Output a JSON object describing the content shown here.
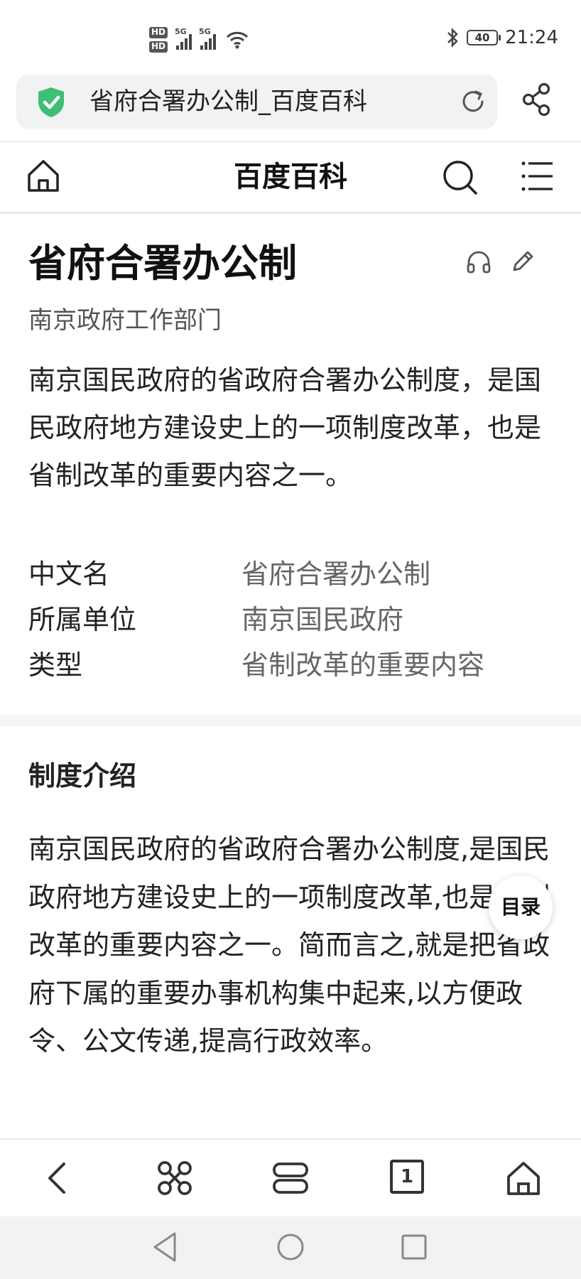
{
  "status_bar": {
    "hd1": "HD",
    "hd2": "HD",
    "net1": "5G",
    "net2": "5G",
    "battery": "40",
    "time": "21:24"
  },
  "address_bar": {
    "title": "省府合署办公制_百度百科",
    "secure_icon": "shield-check-icon",
    "reload_icon": "reload-icon",
    "share_icon": "share-icon"
  },
  "navbar": {
    "home_icon": "home-icon",
    "title": "百度百科",
    "search_icon": "search-icon",
    "menu_icon": "menu-icon"
  },
  "article": {
    "title": "省府合署办公制",
    "subtitle": "南京政府工作部门",
    "summary": "南京国民政府的省政府合署办公制度，是国民政府地方建设史上的一项制度改革，也是省制改革的重要内容之一。",
    "info": [
      {
        "key": "中文名",
        "value": "省府合署办公制"
      },
      {
        "key": "所属单位",
        "value": "南京国民政府"
      },
      {
        "key": "类型",
        "value": "省制改革的重要内容"
      }
    ],
    "section_title": "制度介绍",
    "section_body": "南京国民政府的省政府合署办公制度,是国民政府地方建设史上的一项制度改革,也是省制改革的重要内容之一。简而言之,就是把省政府下属的重要办事机构集中起来,以方便政令、公文传递,提高行政效率。",
    "toc_label": "目录"
  },
  "bottom_bar": {
    "items": [
      "back-icon",
      "apps-icon",
      "tabs-stack-icon",
      "tab-count-icon",
      "home-icon"
    ],
    "tab_count": "1"
  },
  "system_nav": {
    "items": [
      "nav-back-icon",
      "nav-home-icon",
      "nav-recents-icon"
    ]
  },
  "colors": {
    "shield": "#3fbf73",
    "icon": "#333333",
    "divider": "#ececec"
  }
}
